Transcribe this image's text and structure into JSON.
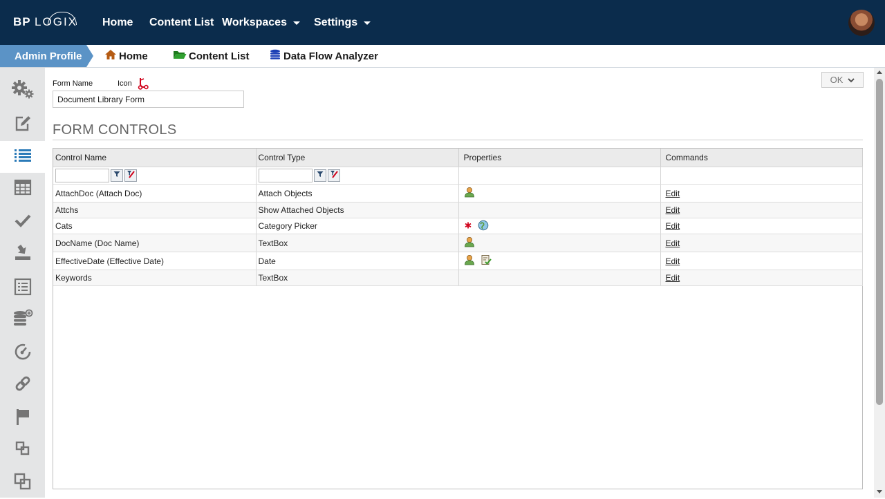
{
  "header": {
    "logo_text_left": "BP",
    "logo_text_right": "LOGIX",
    "nav": [
      {
        "label": "Home"
      },
      {
        "label": "Content List"
      },
      {
        "label": "Workspaces"
      },
      {
        "label": "Settings"
      }
    ]
  },
  "breadcrumb": {
    "profile": "Admin Profile",
    "items": [
      {
        "label": "Home",
        "icon": "home-icon"
      },
      {
        "label": "Content List",
        "icon": "folder-icon"
      },
      {
        "label": "Data Flow Analyzer",
        "icon": "database-icon"
      }
    ]
  },
  "sidebar": {
    "items": [
      {
        "icon": "settings-gears-icon"
      },
      {
        "icon": "edit-icon"
      },
      {
        "icon": "list-icon",
        "active": true
      },
      {
        "icon": "table-icon"
      },
      {
        "icon": "check-icon"
      },
      {
        "icon": "import-icon"
      },
      {
        "icon": "report-list-icon"
      },
      {
        "icon": "database-add-icon"
      },
      {
        "icon": "dashboard-icon"
      },
      {
        "icon": "link-icon"
      },
      {
        "icon": "flag-icon"
      },
      {
        "icon": "window-restore-icon"
      },
      {
        "icon": "copy-windows-icon"
      }
    ]
  },
  "form": {
    "form_name_label": "Form Name",
    "icon_label": "Icon",
    "form_name_value": "Document Library Form",
    "ok_label": "OK"
  },
  "section_title": "FORM CONTROLS",
  "grid": {
    "columns": [
      "Control Name",
      "Control Type",
      "Properties",
      "Commands"
    ],
    "rows": [
      {
        "name": "AttachDoc (Attach Doc)",
        "type": "Attach Objects",
        "props": [
          "user-icon"
        ],
        "command": "Edit"
      },
      {
        "name": "Attchs",
        "type": "Show Attached Objects",
        "props": [],
        "command": "Edit"
      },
      {
        "name": "Cats",
        "type": "Category Picker",
        "props": [
          "required-asterisk-icon",
          "globe-icon"
        ],
        "command": "Edit"
      },
      {
        "name": "DocName (Doc Name)",
        "type": "TextBox",
        "props": [
          "user-icon"
        ],
        "command": "Edit"
      },
      {
        "name": "EffectiveDate (Effective Date)",
        "type": "Date",
        "props": [
          "user-icon",
          "validation-icon"
        ],
        "command": "Edit"
      },
      {
        "name": "Keywords",
        "type": "TextBox",
        "props": [],
        "command": "Edit"
      }
    ]
  },
  "colors": {
    "topbar": "#0b2c4c",
    "profile_crumb": "#5b93c6",
    "sidebar_bg": "#e4e5e6",
    "sidebar_active_icon": "#2a7ab8"
  }
}
